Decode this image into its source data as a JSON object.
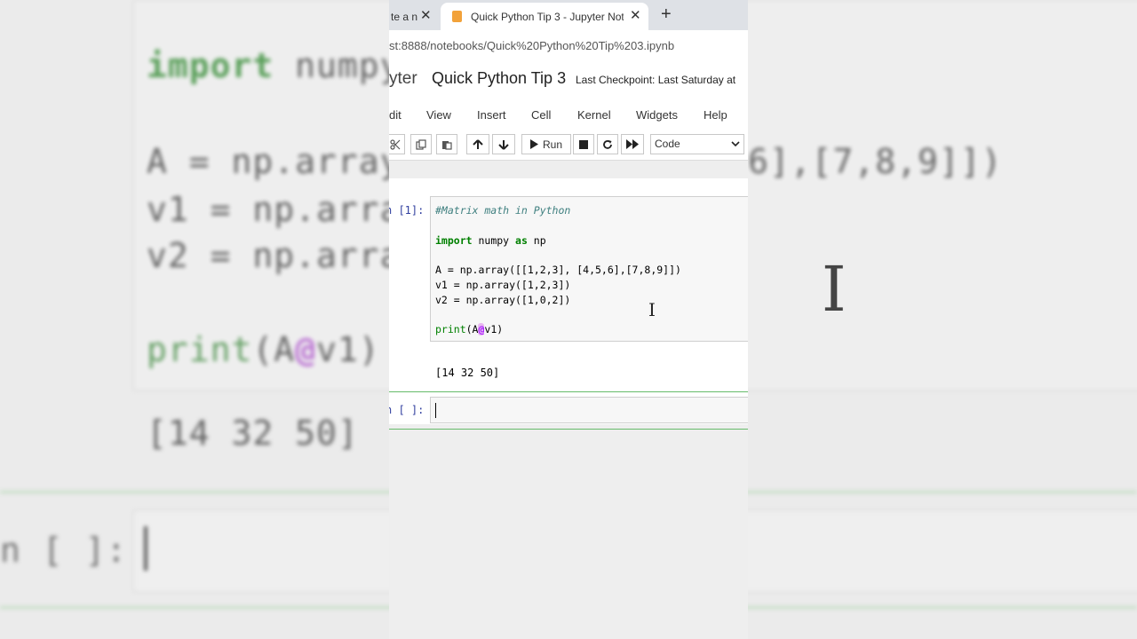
{
  "browser": {
    "inactive_tab_label": "te a n",
    "active_tab_label": "Quick Python Tip 3 - Jupyter Not",
    "url": "st:8888/notebooks/Quick%20Python%20Tip%203.ipynb",
    "new_tab_symbol": "+"
  },
  "notebook": {
    "logo_text": "yter",
    "title": "Quick Python Tip 3",
    "checkpoint": "Last Checkpoint: Last Saturday at"
  },
  "menu": {
    "items": [
      "dit",
      "View",
      "Insert",
      "Cell",
      "Kernel",
      "Widgets",
      "Help"
    ]
  },
  "toolbar": {
    "run_label": "Run",
    "cell_type": "Code"
  },
  "cells": {
    "cell1_prompt": "n [1]:",
    "code": {
      "comment": "#Matrix math in Python",
      "import_kw": "import",
      "import_mod": " numpy ",
      "as_kw": "as",
      "import_alias": " np",
      "line_A": "A = np.array([[1,2,3], [4,5,6],[7,8,9]])",
      "line_v1": "v1 = np.array([1,2,3])",
      "line_v2": "v2 = np.array([1,0,2])",
      "print_fn": "print",
      "print_open": "(A",
      "print_op": "@",
      "print_close": "v1)"
    },
    "output": "[14 32 50]",
    "cell2_prompt": "n [ ]:"
  },
  "background": {
    "line1_kw": "import",
    "line1_rest": " numpy",
    "line2": "A = np.array",
    "line2_right": "6],[7,8,9]])",
    "line3": "v1 = np.arra",
    "line4": "v2 = np.arra",
    "line5_fn": "print",
    "line5_open": "(A",
    "line5_op": "@",
    "line5_close": "v1)",
    "output": "[14 32 50]",
    "prompt": "n [ ]: "
  },
  "colors": {
    "prompt_blue": "#303f9f",
    "keyword_green": "#008000",
    "operator_purple": "#aa22ff",
    "cell_border_green": "#66bb6a"
  }
}
